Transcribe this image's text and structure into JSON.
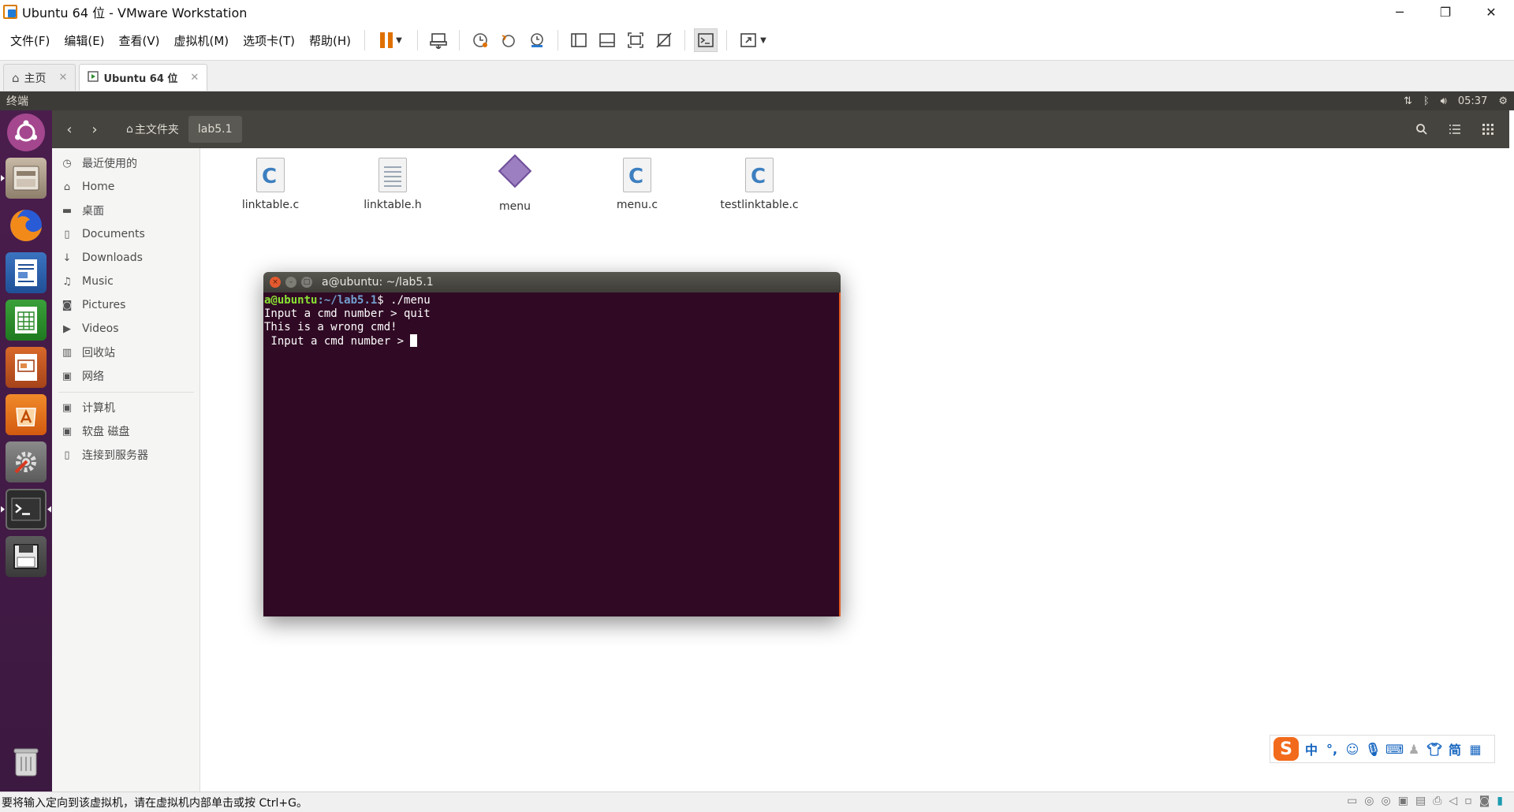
{
  "window": {
    "title": "Ubuntu 64 位 - VMware Workstation",
    "minimize": "─",
    "restore": "❐",
    "close": "✕"
  },
  "menu": [
    "文件(F)",
    "编辑(E)",
    "查看(V)",
    "虚拟机(M)",
    "选项卡(T)",
    "帮助(H)"
  ],
  "tabs": [
    {
      "label": "主页",
      "icon": "home-icon",
      "active": false
    },
    {
      "label": "Ubuntu 64 位",
      "icon": "vm-icon",
      "active": true
    }
  ],
  "tab_close": "✕",
  "ubuntu_panel": {
    "app_name": "终端",
    "time": "05:37"
  },
  "nautilus": {
    "breadcrumbs": [
      "主文件夹",
      "lab5.1"
    ]
  },
  "sidebar": {
    "places": [
      {
        "label": "最近使用的",
        "icon": "clock-icon"
      },
      {
        "label": "Home",
        "icon": "home-icon"
      },
      {
        "label": "桌面",
        "icon": "folder-icon"
      },
      {
        "label": "Documents",
        "icon": "document-icon"
      },
      {
        "label": "Downloads",
        "icon": "download-icon"
      },
      {
        "label": "Music",
        "icon": "music-icon"
      },
      {
        "label": "Pictures",
        "icon": "camera-icon"
      },
      {
        "label": "Videos",
        "icon": "video-icon"
      },
      {
        "label": "回收站",
        "icon": "trash-icon"
      },
      {
        "label": "网络",
        "icon": "network-icon"
      }
    ],
    "devices": [
      {
        "label": "计算机",
        "icon": "computer-icon"
      },
      {
        "label": "软盘 磁盘",
        "icon": "floppy-icon"
      },
      {
        "label": "连接到服务器",
        "icon": "server-icon"
      }
    ]
  },
  "files": [
    {
      "name": "linktable.c",
      "type": "c-source"
    },
    {
      "name": "linktable.h",
      "type": "c-header"
    },
    {
      "name": "menu",
      "type": "executable"
    },
    {
      "name": "menu.c",
      "type": "c-source"
    },
    {
      "name": "testlinktable.c",
      "type": "c-source"
    }
  ],
  "terminal": {
    "title": "a@ubuntu: ~/lab5.1",
    "prompt_user": "a@ubuntu",
    "prompt_path": ":~/lab5.1",
    "prompt_cmd": "$ ./menu",
    "lines": [
      "Input a cmd number > quit",
      "This is a wrong cmd!",
      " Input a cmd number > "
    ]
  },
  "ime": {
    "logo": "S",
    "lang": "中",
    "punct": "°,",
    "simplified": "简"
  },
  "statusbar": {
    "message": "要将输入定向到该虚拟机，请在虚拟机内部单击或按 Ctrl+G。"
  },
  "colors": {
    "launcher": "#4a1d4d",
    "terminal_bg": "#300a24",
    "panel": "#3c3b37",
    "accent": "#e07000"
  }
}
